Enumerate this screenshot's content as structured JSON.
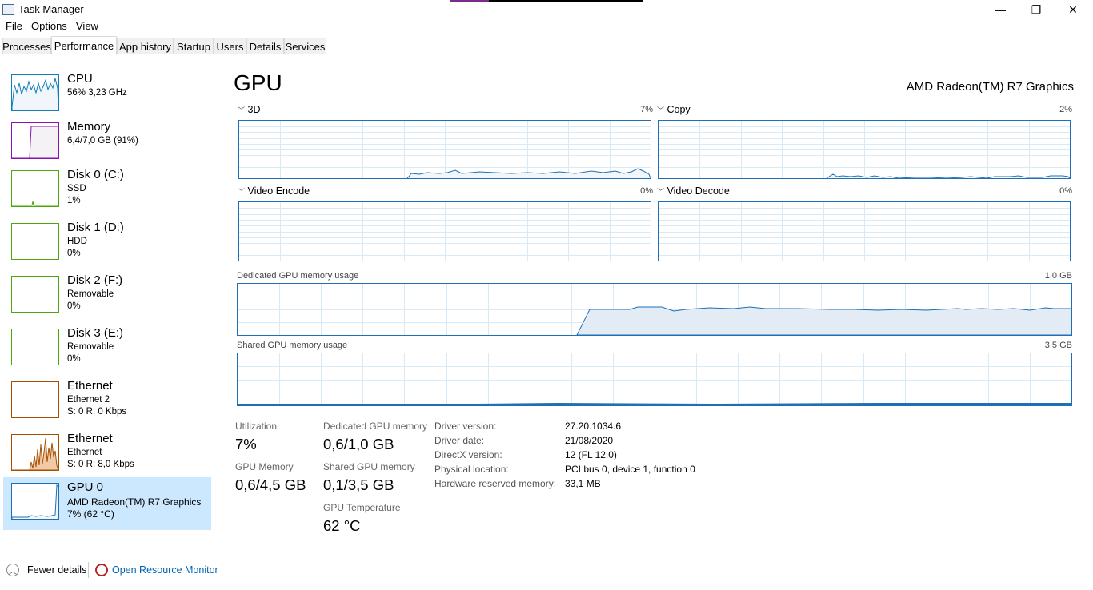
{
  "window": {
    "title": "Task Manager",
    "minimize": "—",
    "maximize": "❐",
    "close": "✕"
  },
  "menu": [
    "File",
    "Options",
    "View"
  ],
  "tabs": [
    "Processes",
    "Performance",
    "App history",
    "Startup",
    "Users",
    "Details",
    "Services"
  ],
  "active_tab": "Performance",
  "sidebar": [
    {
      "name": "CPU",
      "line1": "56% 3,23 GHz",
      "line2": ""
    },
    {
      "name": "Memory",
      "line1": "6,4/7,0 GB (91%)",
      "line2": ""
    },
    {
      "name": "Disk 0 (C:)",
      "line1": "SSD",
      "line2": "1%"
    },
    {
      "name": "Disk 1 (D:)",
      "line1": "HDD",
      "line2": "0%"
    },
    {
      "name": "Disk 2 (F:)",
      "line1": "Removable",
      "line2": "0%"
    },
    {
      "name": "Disk 3 (E:)",
      "line1": "Removable",
      "line2": "0%"
    },
    {
      "name": "Ethernet",
      "line1": "Ethernet 2",
      "line2": "S: 0 R: 0 Kbps"
    },
    {
      "name": "Ethernet",
      "line1": "Ethernet",
      "line2": "S: 0 R: 8,0 Kbps"
    },
    {
      "name": "GPU 0",
      "line1": "AMD Radeon(TM) R7 Graphics",
      "line2": "7% (62 °C)"
    }
  ],
  "gpu": {
    "title": "GPU",
    "model": "AMD Radeon(TM) R7 Graphics",
    "engines": [
      {
        "label": "3D",
        "pct": "7%"
      },
      {
        "label": "Copy",
        "pct": "2%"
      },
      {
        "label": "Video Encode",
        "pct": "0%"
      },
      {
        "label": "Video Decode",
        "pct": "0%"
      }
    ],
    "dedicated_label": "Dedicated GPU memory usage",
    "dedicated_max": "1,0 GB",
    "shared_label": "Shared GPU memory usage",
    "shared_max": "3,5 GB",
    "stats": {
      "utilization_label": "Utilization",
      "utilization": "7%",
      "gpu_memory_label": "GPU Memory",
      "gpu_memory": "0,6/4,5 GB",
      "dedicated_label": "Dedicated GPU memory",
      "dedicated": "0,6/1,0 GB",
      "shared_label": "Shared GPU memory",
      "shared": "0,1/3,5 GB",
      "temp_label": "GPU Temperature",
      "temp": "62 °C"
    },
    "info": [
      {
        "label": "Driver version:",
        "value": "27.20.1034.6"
      },
      {
        "label": "Driver date:",
        "value": "21/08/2020"
      },
      {
        "label": "DirectX version:",
        "value": "12 (FL 12.0)"
      },
      {
        "label": "Physical location:",
        "value": "PCI bus 0, device 1, function 0"
      },
      {
        "label": "Hardware reserved memory:",
        "value": "33,1 MB"
      }
    ]
  },
  "footer": {
    "fewer_details": "Fewer details",
    "open_resource_monitor": "Open Resource Monitor"
  },
  "colors": {
    "gpu_blue": "#1e6fb6",
    "cpu_blue": "#117dbb",
    "memory_purple": "#8b12ae",
    "disk_green": "#4da60c",
    "ethernet_orange": "#a74f01",
    "selected_bg": "#cce8ff"
  }
}
